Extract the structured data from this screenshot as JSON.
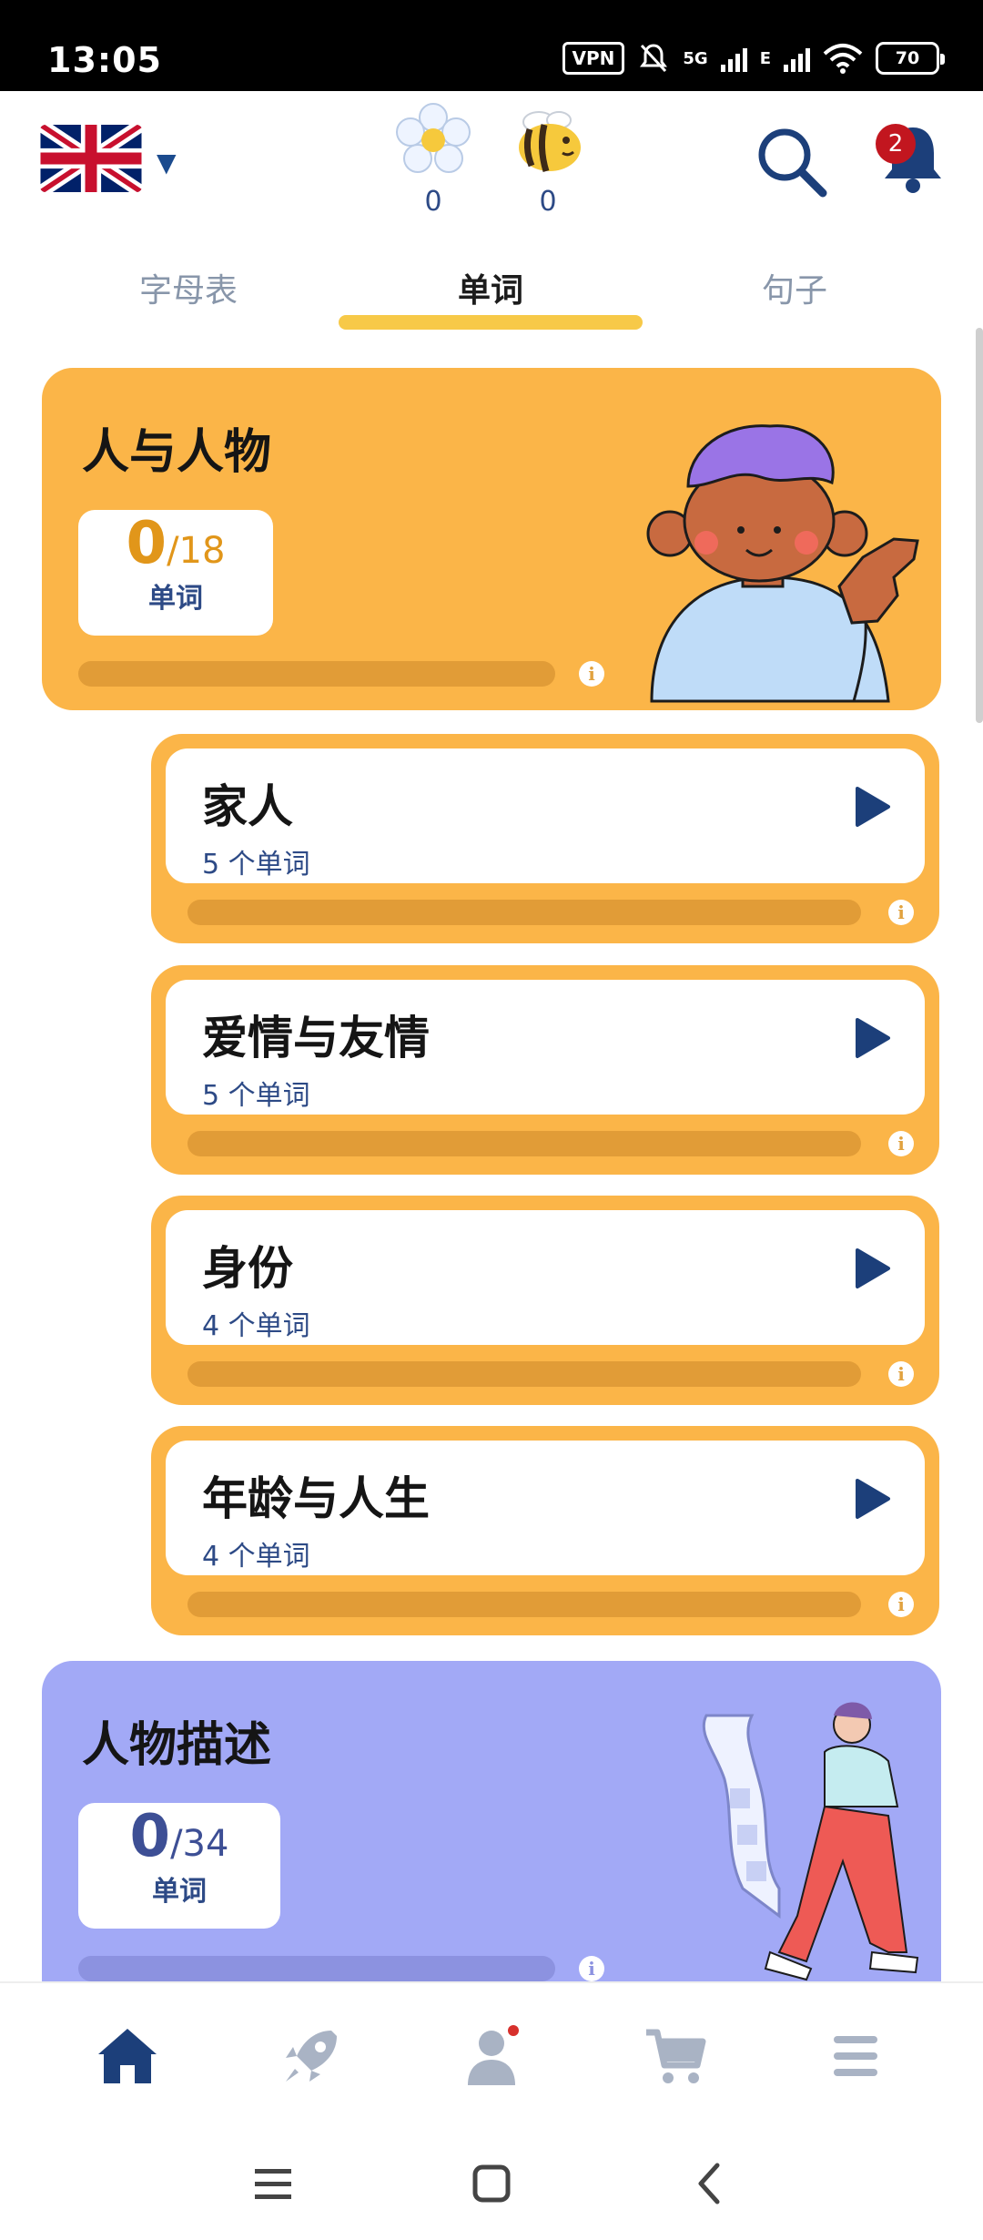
{
  "status_bar": {
    "time": "13:05",
    "vpn": "VPN",
    "network": "5G",
    "network2": "E",
    "battery": "70"
  },
  "header": {
    "flowers": "0",
    "bees": "0",
    "notifications": "2"
  },
  "tabs": [
    {
      "label": "字母表",
      "active": false
    },
    {
      "label": "单词",
      "active": true
    },
    {
      "label": "句子",
      "active": false
    }
  ],
  "categories": [
    {
      "title": "人与人物",
      "done": "0",
      "total": "/18",
      "unit": "单词",
      "progress": 0,
      "color": "#fbb548",
      "lessons": [
        {
          "name": "家人",
          "words": "5 个单词",
          "progress": 0
        },
        {
          "name": "爱情与友情",
          "words": "5 个单词",
          "progress": 0
        },
        {
          "name": "身份",
          "words": "4 个单词",
          "progress": 0
        },
        {
          "name": "年龄与人生",
          "words": "4 个单词",
          "progress": 0
        }
      ]
    },
    {
      "title": "人物描述",
      "done": "0",
      "total": "/34",
      "unit": "单词",
      "progress": 0,
      "color": "#a2a9f6"
    }
  ],
  "icons": {
    "language": "uk-flag-icon",
    "flower": "flower-icon",
    "bee": "bee-icon",
    "search": "search-icon",
    "bell": "bell-icon",
    "play": "play-icon",
    "info": "info-icon",
    "nav": [
      "home-icon",
      "rocket-icon",
      "profile-icon",
      "cart-icon",
      "menu-icon"
    ],
    "system": [
      "recents-icon",
      "home-button-icon",
      "back-icon"
    ]
  },
  "colors": {
    "accent_yellow": "#f7c948",
    "orange_card": "#fbb548",
    "purple_card": "#a2a9f6",
    "navy": "#2d4a86",
    "badge_red": "#c2161f"
  }
}
